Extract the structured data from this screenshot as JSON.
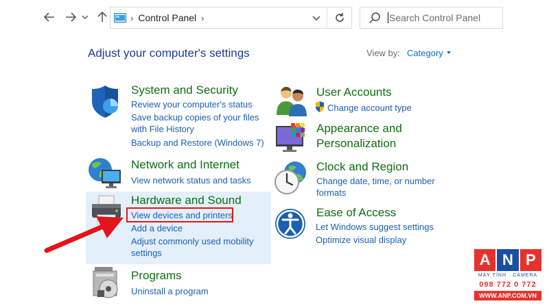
{
  "address_bar": {
    "breadcrumb": "Control Panel",
    "search_placeholder": "Search Control Panel"
  },
  "header": {
    "title": "Adjust your computer's settings",
    "view_by_label": "View by:",
    "view_by_value": "Category"
  },
  "categories": {
    "system_security": {
      "title": "System and Security",
      "links": [
        "Review your computer's status",
        "Save backup copies of your files",
        "with File History",
        "Backup and Restore (Windows 7)"
      ]
    },
    "network": {
      "title": "Network and Internet",
      "links": [
        "View network status and tasks"
      ]
    },
    "hardware": {
      "title": "Hardware and Sound",
      "links": [
        "View devices and printers",
        "Add a device",
        "Adjust commonly used mobility",
        "settings"
      ]
    },
    "programs": {
      "title": "Programs",
      "links": [
        "Uninstall a program"
      ]
    },
    "user_accounts": {
      "title": "User Accounts",
      "links": [
        "Change account type"
      ]
    },
    "appearance": {
      "title_line1": "Appearance and",
      "title_line2": "Personalization"
    },
    "clock": {
      "title": "Clock and Region",
      "links": [
        "Change date, time, or number",
        "formats"
      ]
    },
    "ease": {
      "title": "Ease of Access",
      "links": [
        "Let Windows suggest settings",
        "Optimize visual display"
      ]
    }
  },
  "watermark": {
    "letters": [
      "A",
      "N",
      "P"
    ],
    "subtitle": "MÁY TÍNH · CAMERA",
    "phone": "098 772 0 772",
    "website": "WWW.ANP.COM.VN"
  },
  "colors": {
    "title_blue": "#1e3d8f",
    "category_green": "#0f6e0f",
    "link_blue": "#1a5fb4",
    "highlight": "#e3effa",
    "annotation_red": "#e3151a"
  }
}
